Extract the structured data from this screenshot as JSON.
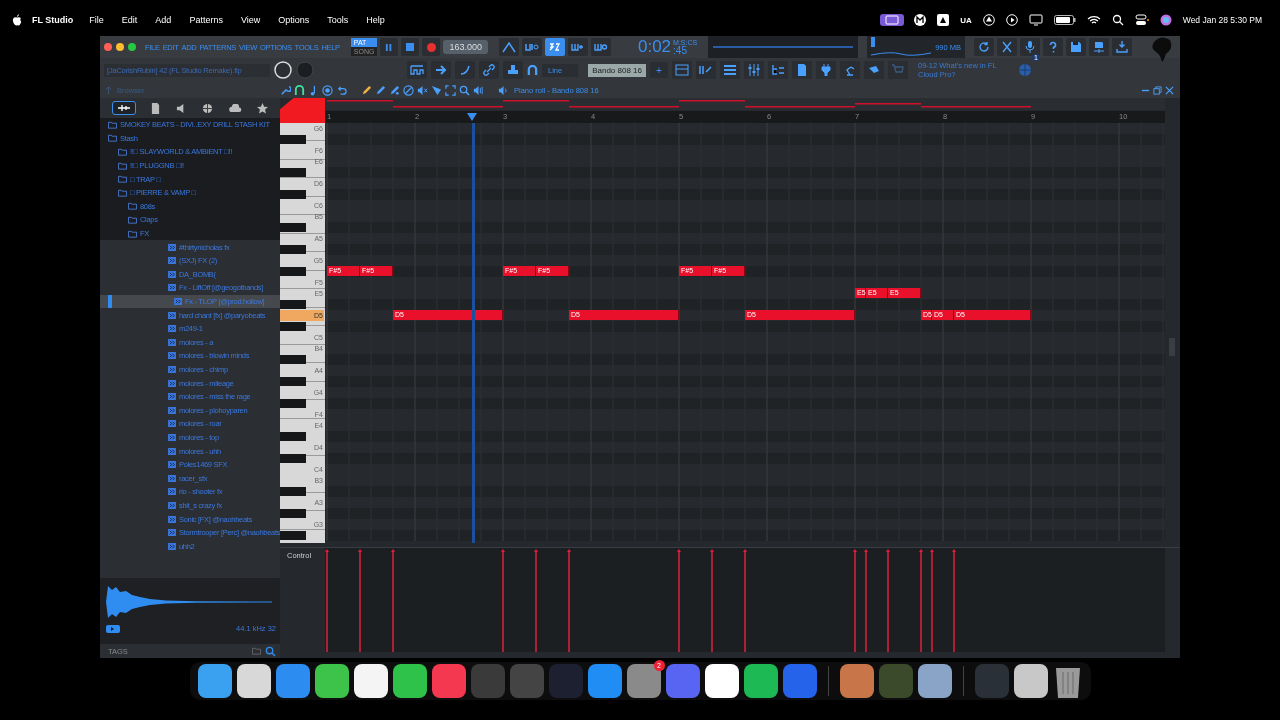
{
  "menu_bar": {
    "app": "FL Studio",
    "items": [
      "File",
      "Edit",
      "Add",
      "Patterns",
      "View",
      "Options",
      "Tools",
      "Help"
    ],
    "keyboard": "UA",
    "clock": "Wed Jan 28  5:30 PM"
  },
  "window": {
    "menus": [
      "FILE",
      "EDIT",
      "ADD",
      "PATTERNS",
      "VIEW",
      "OPTIONS",
      "TOOLS",
      "HELP"
    ],
    "mode": [
      {
        "label": "PAT",
        "selected": true
      },
      {
        "label": "SONG",
        "selected": false
      }
    ],
    "tempo": "163.000",
    "time": "0:02",
    "time_cs": ":45",
    "time_unit": "M:S:CS",
    "memory": "990 MB",
    "project": "[JaCorishRubin] 42 (FL Studio Remake).flp",
    "snap": "Line",
    "pattern": "Bando 808 16",
    "pattern_add": "+",
    "news": "09-12  What's new in FL Cloud Pro?",
    "news_badge": "1",
    "browser_label": "Browser"
  },
  "browser": {
    "tree": [
      {
        "label": "SMOKEY BEATS - DIVI..EXY DRILL STASH KIT",
        "kind": "folder",
        "selected": false
      },
      {
        "label": "Stash",
        "kind": "folder",
        "selected": false,
        "children": [
          {
            "label": "!!□ SLAYWORLD & AMBIENT □!!",
            "kind": "folder",
            "selected": false
          },
          {
            "label": "!!□ PLUGGNB □!!",
            "kind": "folder",
            "selected": false
          },
          {
            "label": "□ TRAP □",
            "kind": "folder",
            "selected": false
          },
          {
            "label": "□ PIERRE & VAMP □",
            "kind": "folder",
            "selected": false,
            "children": [
              {
                "label": "808s",
                "kind": "folder",
                "selected": false
              },
              {
                "label": "Claps",
                "kind": "folder",
                "selected": false
              },
              {
                "label": "FX",
                "kind": "folder",
                "selected": false,
                "children": [
                  {
                    "label": "#thirtynicholas fx",
                    "kind": "file",
                    "selected": false
                  },
                  {
                    "label": "(SXJ) FX (2)",
                    "kind": "file",
                    "selected": false
                  },
                  {
                    "label": "DA_BOMB(",
                    "kind": "file",
                    "selected": false
                  },
                  {
                    "label": "Fx - LiftOff [@geogotbands]",
                    "kind": "file",
                    "selected": false
                  },
                  {
                    "label": "Fx - TLOP [@prod.hollow]",
                    "kind": "file",
                    "selected": true
                  },
                  {
                    "label": "hard chant [fx] @paryobeats",
                    "kind": "file",
                    "selected": false
                  },
                  {
                    "label": "m249-1",
                    "kind": "file",
                    "selected": false
                  },
                  {
                    "label": "molores - a",
                    "kind": "file",
                    "selected": false
                  },
                  {
                    "label": "molores - blowin minds",
                    "kind": "file",
                    "selected": false
                  },
                  {
                    "label": "molores - chimp",
                    "kind": "file",
                    "selected": false
                  },
                  {
                    "label": "molores - mileage",
                    "kind": "file",
                    "selected": false
                  },
                  {
                    "label": "molores - miss the rage",
                    "kind": "file",
                    "selected": false
                  },
                  {
                    "label": "molores - plohoyparen",
                    "kind": "file",
                    "selected": false
                  },
                  {
                    "label": "molores - roar",
                    "kind": "file",
                    "selected": false
                  },
                  {
                    "label": "molores - top",
                    "kind": "file",
                    "selected": false
                  },
                  {
                    "label": "molores - uhh",
                    "kind": "file",
                    "selected": false
                  },
                  {
                    "label": "Poles1469 SFX",
                    "kind": "file",
                    "selected": false
                  },
                  {
                    "label": "racer_sfx",
                    "kind": "file",
                    "selected": false
                  },
                  {
                    "label": "rio - shooter fx",
                    "kind": "file",
                    "selected": false
                  },
                  {
                    "label": "shit_s crazy fx",
                    "kind": "file",
                    "selected": false
                  },
                  {
                    "label": "Sonic [FX] @naohbeats",
                    "kind": "file",
                    "selected": false
                  },
                  {
                    "label": "Stormtrooper [Perc] @naohbeats",
                    "kind": "file",
                    "selected": false
                  },
                  {
                    "label": "uhh2",
                    "kind": "file",
                    "selected": false
                  }
                ]
              }
            ]
          }
        ]
      }
    ],
    "sample_info": "44.1 kHz 32",
    "tags": "TAGS"
  },
  "piano_roll": {
    "title": "Piano roll - Bando 808 16",
    "bars": [
      "1",
      "2",
      "3",
      "4",
      "5",
      "6",
      "7",
      "8",
      "9",
      "10"
    ],
    "keys": [
      {
        "label": "G6",
        "selected": false
      },
      {
        "label": "F6",
        "selected": false
      },
      {
        "label": "E6",
        "selected": false
      },
      {
        "label": "D6",
        "selected": false
      },
      {
        "label": "C6",
        "selected": false
      },
      {
        "label": "B5",
        "selected": false
      },
      {
        "label": "A5",
        "selected": false
      },
      {
        "label": "G5",
        "selected": false
      },
      {
        "label": "F5",
        "selected": false
      },
      {
        "label": "E5",
        "selected": false
      },
      {
        "label": "D5",
        "selected": true
      },
      {
        "label": "C5",
        "selected": false
      },
      {
        "label": "B4",
        "selected": false
      },
      {
        "label": "A4",
        "selected": false
      },
      {
        "label": "G4",
        "selected": false
      },
      {
        "label": "F4",
        "selected": false
      },
      {
        "label": "E4",
        "selected": false
      },
      {
        "label": "D4",
        "selected": false
      },
      {
        "label": "C4",
        "selected": false
      },
      {
        "label": "B3",
        "selected": false
      },
      {
        "label": "A3",
        "selected": false
      },
      {
        "label": "G3",
        "selected": false
      }
    ],
    "notes": [
      {
        "label": "F#5"
      },
      {
        "label": "F#5"
      },
      {
        "label": "D5"
      },
      {
        "label": "F#5"
      },
      {
        "label": "F#5"
      },
      {
        "label": "D5"
      },
      {
        "label": "F#5"
      },
      {
        "label": "F#5"
      },
      {
        "label": "D5"
      },
      {
        "label": "E5"
      },
      {
        "label": "E5"
      },
      {
        "label": "E5"
      },
      {
        "label": "D5"
      },
      {
        "label": "D5"
      },
      {
        "label": "D5"
      }
    ],
    "control_label": "Control"
  },
  "dock": {
    "badge": "2"
  }
}
